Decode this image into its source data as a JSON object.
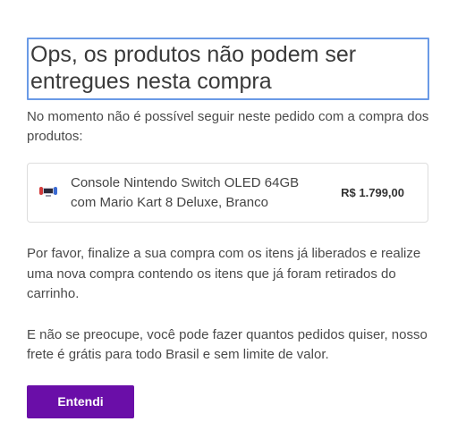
{
  "dialog": {
    "title": "Ops, os produtos não podem ser entregues nesta compra",
    "intro": "No momento não é possível seguir neste pedido com a compra dos produtos:",
    "product": {
      "icon": "console-product-thumbnail",
      "name": "Console Nintendo Switch OLED 64GB com Mario Kart 8 Deluxe, Branco",
      "price": "R$ 1.799,00"
    },
    "paragraph_1": "Por favor, finalize a sua compra com os itens já liberados e realize uma nova compra contendo os itens que já foram retirados do carrinho.",
    "paragraph_2": "E não se preocupe, você pode fazer quantos pedidos quiser, nosso frete é grátis para todo Brasil e sem limite de valor.",
    "button_label": "Entendi"
  },
  "colors": {
    "accent": "#6a0ea8",
    "focus_border": "#6a9ae6",
    "card_border": "#dddddd"
  }
}
